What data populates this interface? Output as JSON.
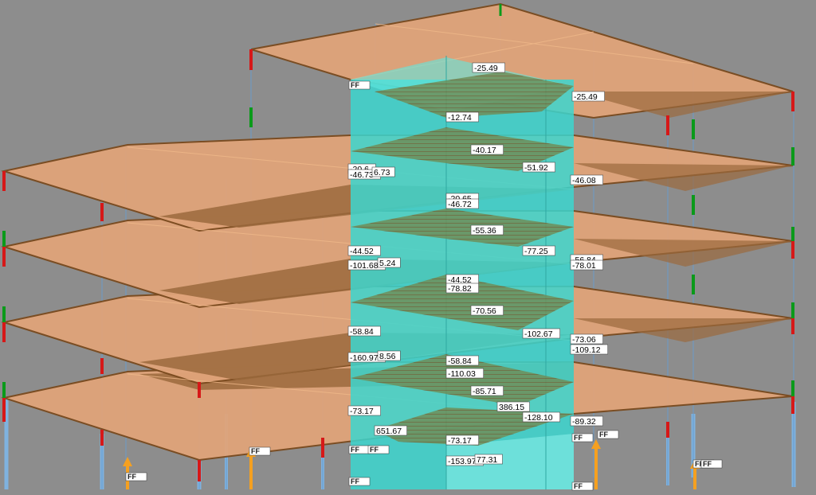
{
  "colors": {
    "background": "#8d8d8d",
    "slab_fill": "#e0a47a",
    "slab_dark": "#9b6a3d",
    "slab_edge": "#7a4a1e",
    "core_cyan": "#3cd6cf",
    "core_diagram": "#6f8f5a",
    "column_blue": "#7fb2df",
    "support_orange": "#f5a020",
    "red": "#d61818",
    "green": "#0a9a1a"
  },
  "result_labels": [
    "-25.49",
    "-25.49",
    "-12.74",
    "-40.17",
    "-51.92",
    "-20.6",
    "-46.73",
    "6.73",
    "-46.08",
    "-20.65",
    "-46.72",
    "-55.36",
    "-44.52",
    "-77.25",
    "-101.68",
    "5.24",
    "-56.84",
    "-78.01",
    "-44.52",
    "-78.82",
    "-70.56",
    "-58.84",
    "-102.67",
    "-73.06",
    "-109.12",
    "-160.97",
    "8.56",
    "-58.84",
    "-110.03",
    "-85.71",
    "386.15",
    "-73.17",
    "-128.10",
    "-89.32",
    "651.67",
    "-73.17",
    "-153.97",
    "77.31"
  ],
  "support_tags": [
    "FF",
    "FF",
    "FF",
    "FF",
    "FF",
    "FF",
    "FF",
    "FF",
    "FF",
    "FF",
    "FF"
  ]
}
